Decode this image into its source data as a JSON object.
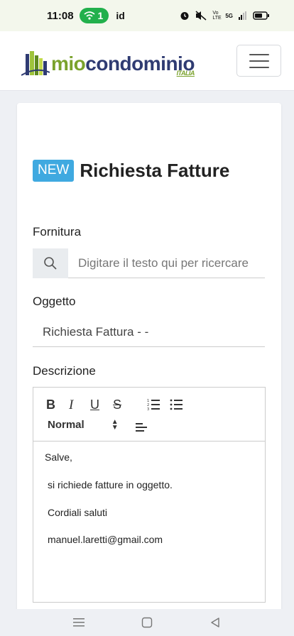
{
  "status_bar": {
    "time": "11:08",
    "hotspot_count": "1",
    "carrier_id": "id",
    "volte_label": "Vo LTE",
    "network_label": "5G"
  },
  "navbar": {
    "logo_text_primary": "mio",
    "logo_text_secondary": "condominio",
    "logo_subtext": "ITALIA",
    "brand_green": "#7aa22c",
    "brand_blue": "#2f3b72"
  },
  "page": {
    "badge": "NEW",
    "title": "Richiesta Fatture",
    "badge_color": "#3fa9e0"
  },
  "form": {
    "fornitura_label": "Fornitura",
    "search_placeholder": "Digitare il testo qui per ricercare",
    "oggetto_label": "Oggetto",
    "oggetto_value": "Richiesta Fattura  - -",
    "descrizione_label": "Descrizione"
  },
  "editor": {
    "bold": "B",
    "italic": "I",
    "underline": "U",
    "strike": "S",
    "header_select": "Normal",
    "body": {
      "line1": "Salve,",
      "line2": "si richiede fatture in oggetto.",
      "line3": "Cordiali saluti",
      "line4": "manuel.laretti@gmail.com"
    }
  }
}
